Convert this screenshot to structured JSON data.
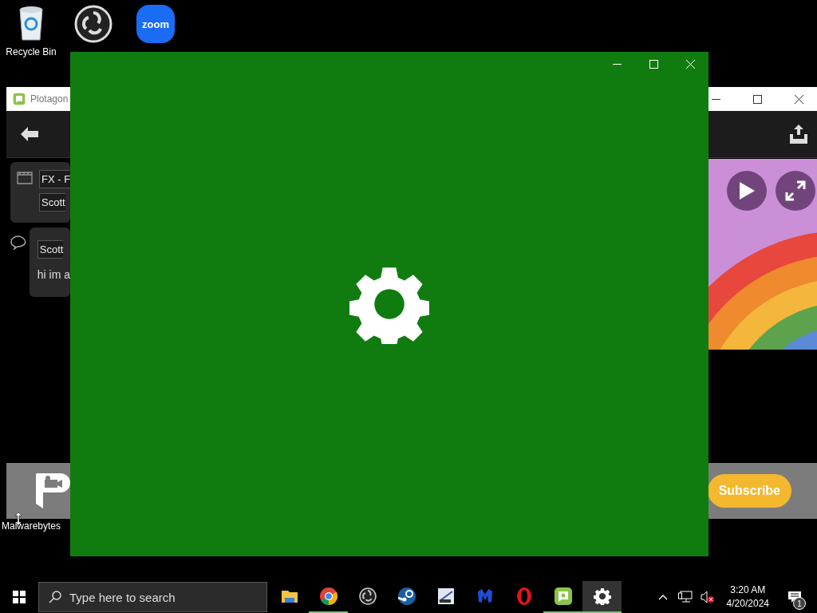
{
  "desktop_icons": [
    {
      "label": "Recycle Bin",
      "kind": "recycle"
    },
    {
      "kind": "obs"
    },
    {
      "kind": "zoom",
      "logo_text": "zoom"
    }
  ],
  "desktop_label": {
    "label": "Malwarebytes"
  },
  "plotagon": {
    "title": "Plotagon",
    "cards": [
      {
        "kind": "scene",
        "fields": [
          "FX - F",
          "Scott"
        ]
      },
      {
        "kind": "dialogue",
        "fields": [
          "Scott"
        ],
        "line": "hi im a"
      }
    ],
    "subscribe": "Subscribe"
  },
  "taskbar": {
    "search": {
      "placeholder": "Type here to search"
    },
    "apps": [
      {
        "kind": "explorer",
        "running": false,
        "selected": false
      },
      {
        "kind": "chrome",
        "running": true,
        "selected": false
      },
      {
        "kind": "obs",
        "running": false,
        "selected": false
      },
      {
        "kind": "steam",
        "running": false,
        "selected": false
      },
      {
        "kind": "tool",
        "running": false,
        "selected": false
      },
      {
        "kind": "malware",
        "running": false,
        "selected": false
      },
      {
        "kind": "opera",
        "running": false,
        "selected": false
      },
      {
        "kind": "plotagon",
        "running": true,
        "selected": false
      },
      {
        "kind": "settings",
        "running": true,
        "selected": true
      }
    ],
    "volume": {
      "muted": true
    },
    "clock": {
      "time": "3:20 AM",
      "date": "4/20/2024"
    },
    "notifications": {
      "count": "1"
    }
  }
}
